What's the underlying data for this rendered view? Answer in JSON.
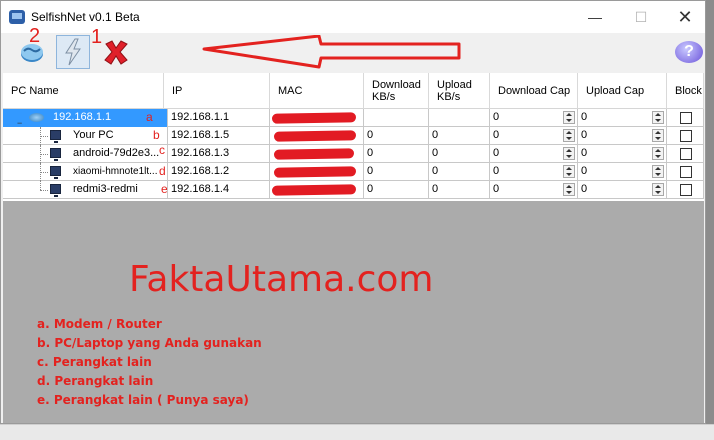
{
  "window": {
    "title": "SelfishNet v0.1 Beta",
    "minimize": "—",
    "maximize": "☐",
    "close": "✕"
  },
  "toolbar": {
    "label_2": "2",
    "label_1": "1",
    "help": "?"
  },
  "columns": [
    "PC Name",
    "IP",
    "MAC",
    "Download KB/s",
    "Upload KB/s",
    "Download Cap",
    "Upload Cap",
    "Block"
  ],
  "rows": [
    {
      "name": "192.168.1.1",
      "letter": "a",
      "ip": "192.168.1.1",
      "download": "",
      "upload": "",
      "dcap": "0",
      "ucap": "0",
      "type": "router"
    },
    {
      "name": "Your PC",
      "letter": "b",
      "ip": "192.168.1.5",
      "download": "0",
      "upload": "0",
      "dcap": "0",
      "ucap": "0",
      "type": "pc"
    },
    {
      "name": "android-79d2e3...",
      "letter": "c",
      "ip": "192.168.1.3",
      "download": "0",
      "upload": "0",
      "dcap": "0",
      "ucap": "0",
      "type": "pc"
    },
    {
      "name": "xiaomi-hmnote1lt...",
      "letter": "d",
      "ip": "192.168.1.2",
      "download": "0",
      "upload": "0",
      "dcap": "0",
      "ucap": "0",
      "type": "pc"
    },
    {
      "name": "redmi3-redmi",
      "letter": "e",
      "ip": "192.168.1.4",
      "download": "0",
      "upload": "0",
      "dcap": "0",
      "ucap": "0",
      "type": "pc"
    }
  ],
  "watermark": "FaktaUtama.com",
  "legend": [
    "a. Modem / Router",
    "b. PC/Laptop yang Anda gunakan",
    "c. Perangkat lain",
    "d. Perangkat lain",
    "e. Perangkat lain ( Punya saya)"
  ],
  "accent": "#e3221f",
  "selection": "#3399ff"
}
